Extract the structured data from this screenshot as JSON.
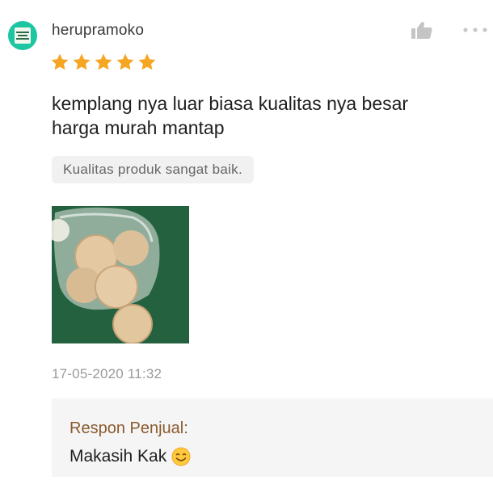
{
  "review": {
    "username": "herupramoko",
    "rating": 5,
    "rating_max": 5,
    "text_lines": [
      "kemplang nya luar biasa kualitas nya besar",
      "harga murah mantap"
    ],
    "tag": "Kualitas produk sangat baik.",
    "timestamp": "17-05-2020 11:32",
    "icons": {
      "like": "thumbs-up-icon",
      "more": "more-options-icon",
      "star": "star-icon",
      "emoji": "smiling-face-icon"
    },
    "colors": {
      "star": "#f5a623",
      "avatar": "#1cc6a0",
      "seller_label": "#8a5a2e"
    }
  },
  "seller_response": {
    "label": "Respon Penjual:",
    "message": "Makasih Kak"
  }
}
